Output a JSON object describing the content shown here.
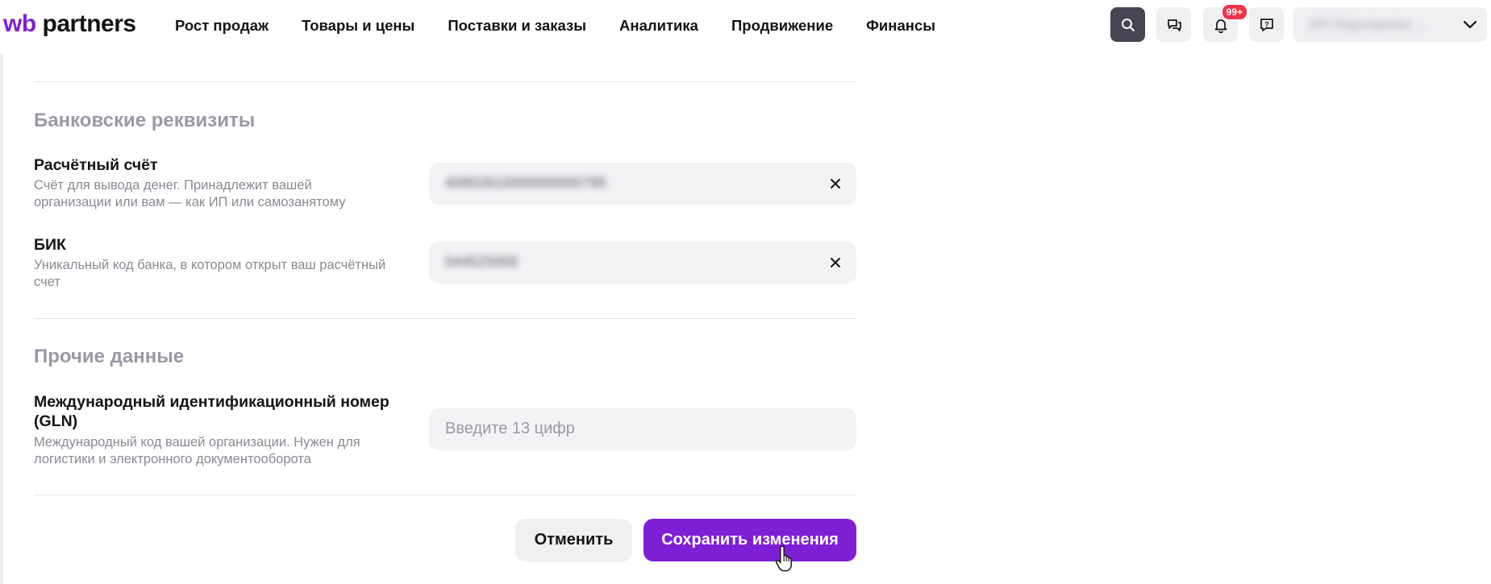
{
  "header": {
    "logo_prefix": "wb",
    "logo_text": "partners",
    "nav": [
      "Рост продаж",
      "Товары и цены",
      "Поставки и заказы",
      "Аналитика",
      "Продвижение",
      "Финансы"
    ],
    "notification_badge": "99+",
    "account_name": "ИП Пархоменко ..."
  },
  "bank": {
    "section_title": "Банковские реквизиты",
    "account": {
      "label": "Расчётный счёт",
      "hint": "Счёт для вывода денег. Принадлежит вашей организации или вам — как ИП или самозанятому",
      "value": "40802810000000000785"
    },
    "bik": {
      "label": "БИК",
      "hint": "Уникальный код банка, в котором открыт ваш расчётный счет",
      "value": "044525000"
    }
  },
  "other": {
    "section_title": "Прочие данные",
    "gln": {
      "label": "Международный идентификационный номер (GLN)",
      "hint": "Международный код вашей организации. Нужен для логистики и электронного документооборота",
      "placeholder": "Введите 13 цифр"
    }
  },
  "actions": {
    "cancel_label": "Отменить",
    "save_label": "Сохранить изменения"
  },
  "colors": {
    "accent": "#7e1fd6",
    "badge": "#f0334a",
    "search_button": "#454553"
  },
  "icons": [
    "search-icon",
    "chat-icon",
    "bell-icon",
    "help-icon",
    "chevron-down-icon",
    "clear-icon",
    "pointer-cursor-icon"
  ]
}
